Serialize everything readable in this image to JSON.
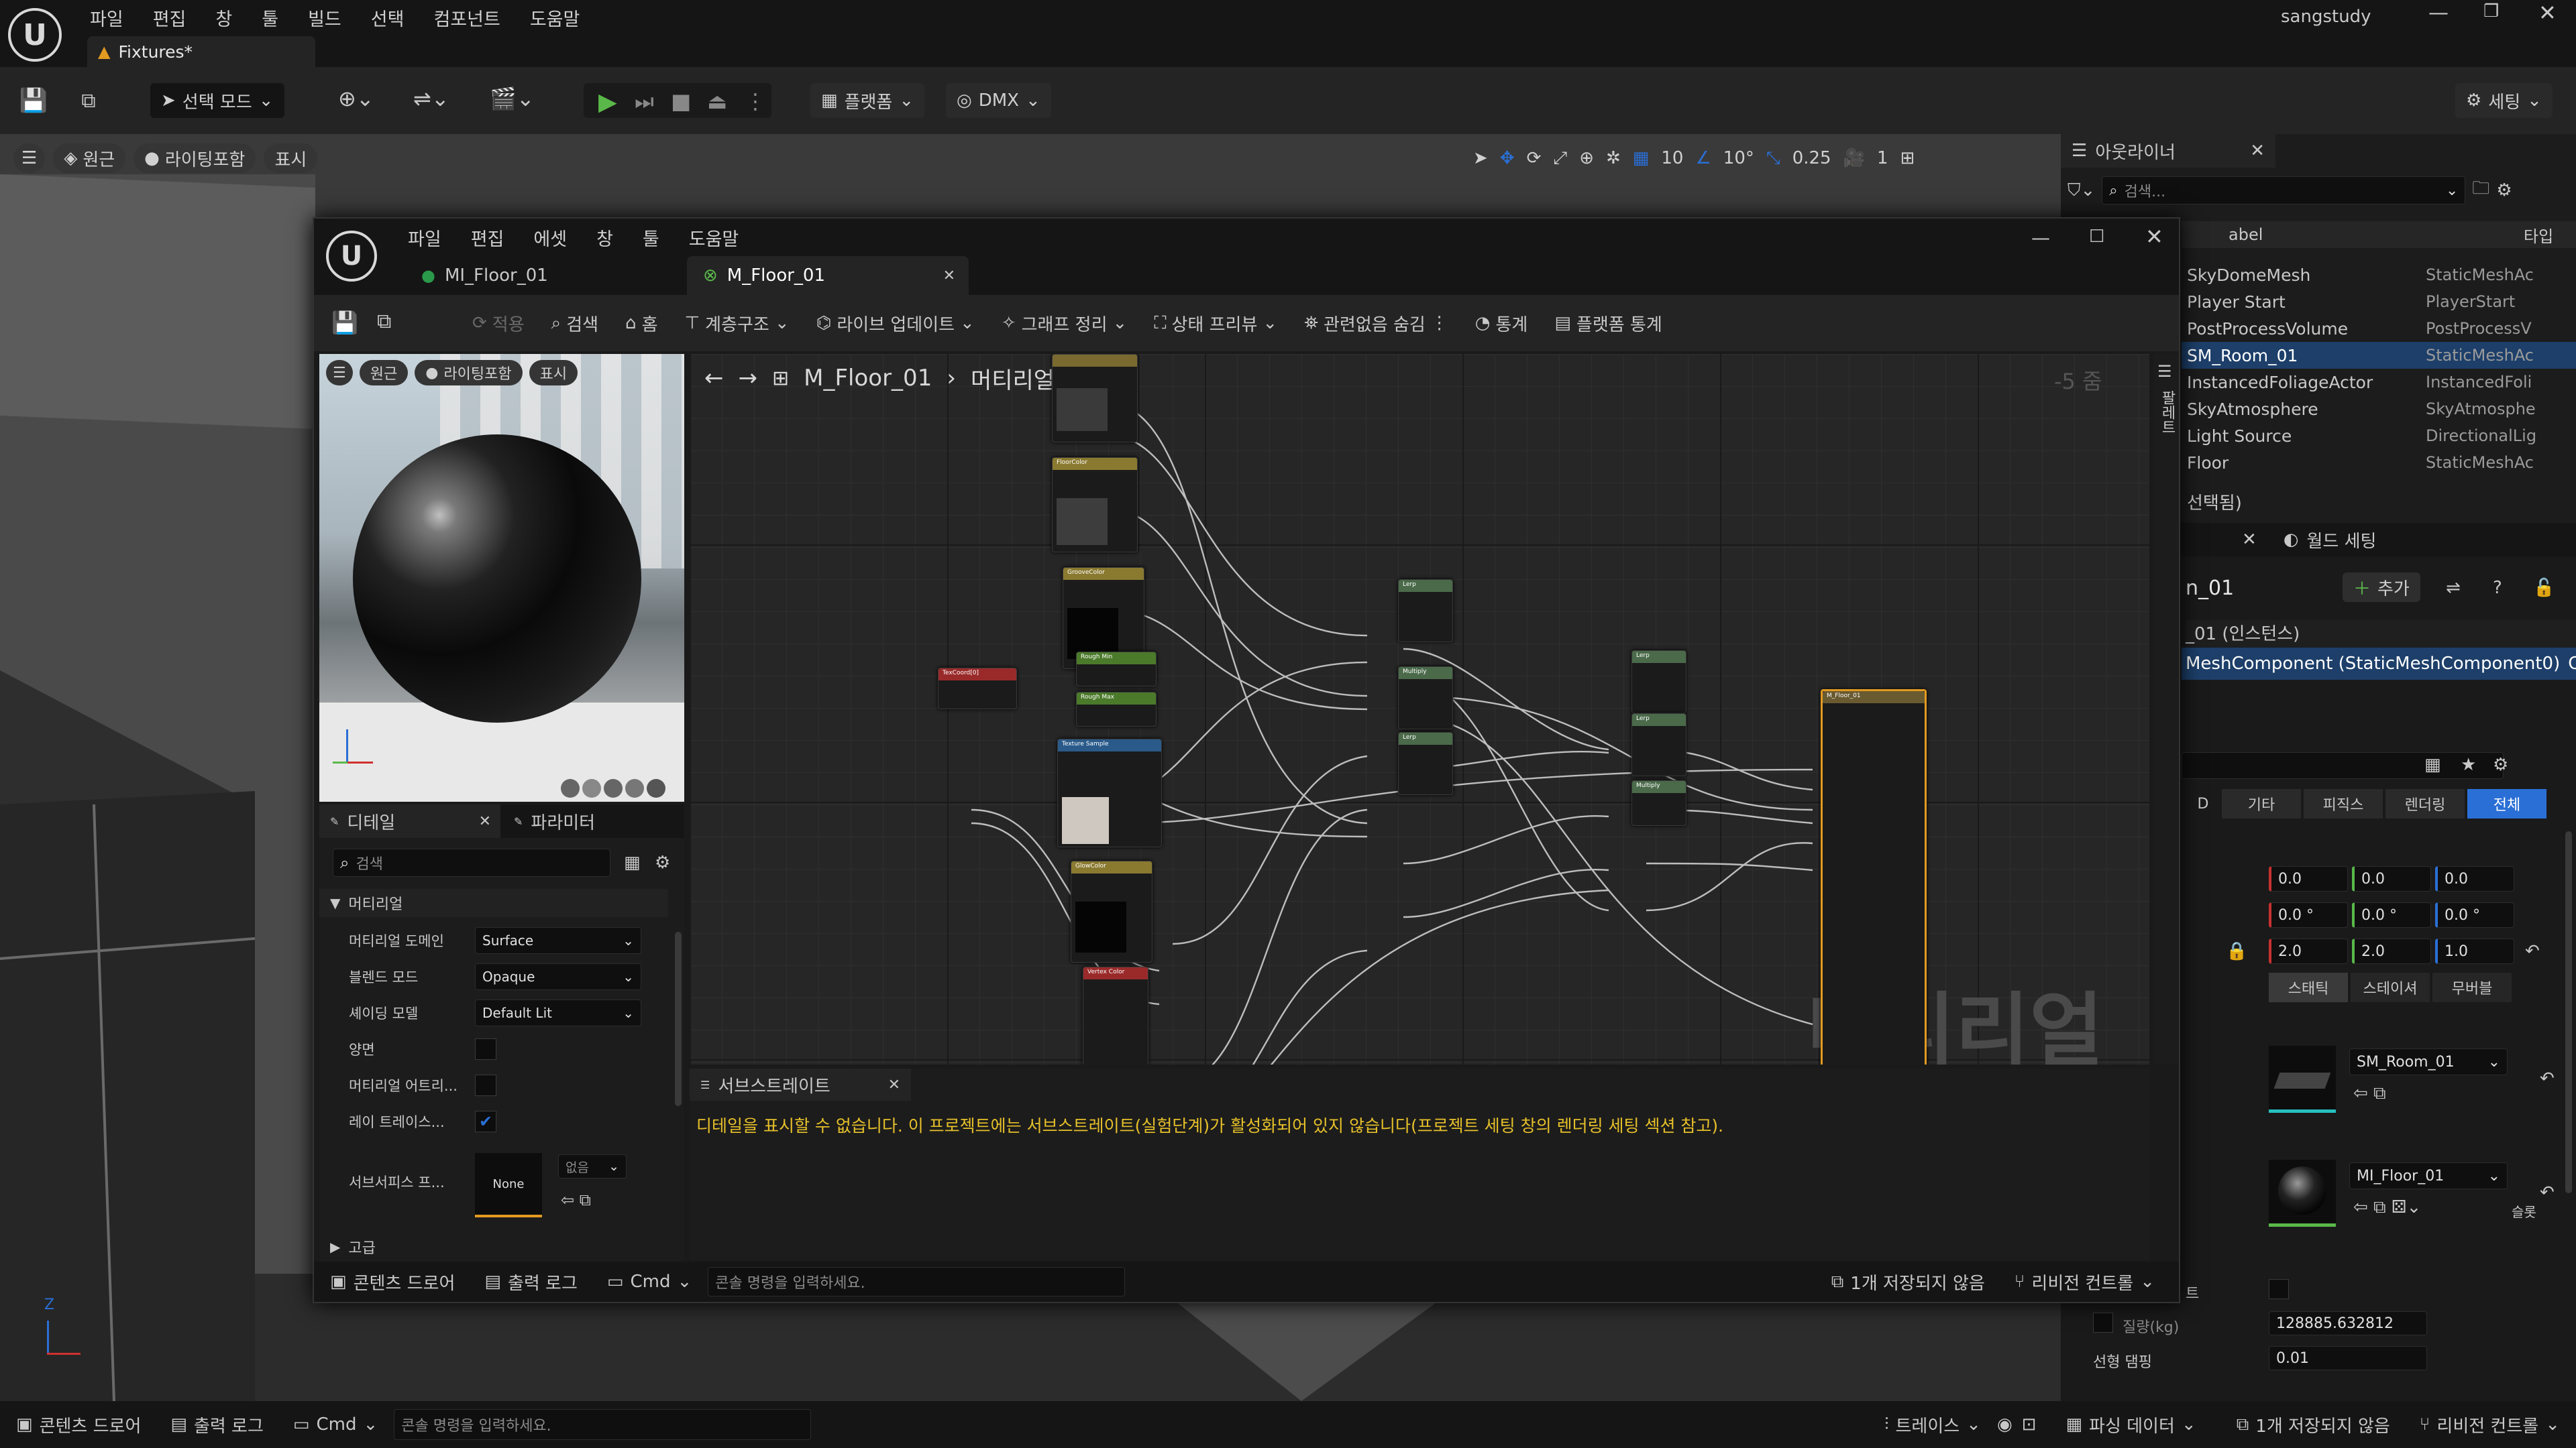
{
  "main_menu": [
    "파일",
    "편집",
    "창",
    "툴",
    "빌드",
    "선택",
    "컴포넌트",
    "도움말"
  ],
  "user": "sangstudy",
  "level_tab": "Fixtures*",
  "main_toolbar": {
    "select_mode": "선택 모드",
    "platforms": "플랫폼",
    "dmx": "DMX",
    "settings": "세팅"
  },
  "viewport_pills": {
    "perspective": "원근",
    "lit": "라이팅포함",
    "show": "표시"
  },
  "viewport_right": {
    "grid": "10",
    "angle": "10°",
    "scale": "0.25",
    "camera": "1"
  },
  "outliner": {
    "title": "아웃라이너",
    "search_placeholder": "검색...",
    "col_label": "abel",
    "col_type": "타입",
    "rows": [
      {
        "label": "SkyDomeMesh",
        "type": "StaticMeshAc"
      },
      {
        "label": "Player Start",
        "type": "PlayerStart"
      },
      {
        "label": "PostProcessVolume",
        "type": "PostProcessV"
      },
      {
        "label": "SM_Room_01",
        "type": "StaticMeshAc"
      },
      {
        "label": "InstancedFoliageActor",
        "type": "InstancedFoli"
      },
      {
        "label": "SkyAtmosphere",
        "type": "SkyAtmosphe"
      },
      {
        "label": "Light Source",
        "type": "DirectionalLig"
      },
      {
        "label": "Floor",
        "type": "StaticMeshAc"
      }
    ],
    "selected_count": "선택됨)"
  },
  "details_right": {
    "world_settings": "월드 세팅",
    "object_name": "n_01",
    "add": "추가",
    "instance": "_01 (인스턴스)",
    "component": "MeshComponent (StaticMeshComponent0)",
    "component_suffix": "C",
    "filter_tabs": [
      "D",
      "기타",
      "피직스",
      "렌더링",
      "전체"
    ],
    "loc": [
      "0.0",
      "0.0",
      "0.0"
    ],
    "rot": [
      "0.0 °",
      "0.0 °",
      "0.0 °"
    ],
    "scale": [
      "2.0",
      "2.0",
      "1.0"
    ],
    "mobility": [
      "스태틱",
      "스테이셔",
      "무버블"
    ],
    "mesh": "SM_Room_01",
    "material": "MI_Floor_01",
    "material_suffix": "슬롯",
    "mass_label": "질량(kg)",
    "mass_value": "128885.632812",
    "damp_label": "선형 댐핑",
    "damp_value": "0.01",
    "prop_label": "트"
  },
  "mat_editor": {
    "menu": [
      "파일",
      "편집",
      "에셋",
      "창",
      "툴",
      "도움말"
    ],
    "tabs": [
      "MI_Floor_01",
      "M_Floor_01"
    ],
    "toolbar": [
      "적용",
      "검색",
      "홈",
      "계층구조",
      "라이브 업데이트",
      "그래프 정리",
      "상태 프리뷰",
      "관련없음 숨김",
      "통계",
      "플랫폼 통계"
    ],
    "preview_pills": [
      "원근",
      "라이팅포함",
      "표시"
    ],
    "breadcrumb_root": "M_Floor_01",
    "breadcrumb_leaf": "머티리얼 그래프",
    "zoom": "-5 줌",
    "palette": "팔레트",
    "watermark": "머티리얼",
    "details_tab": "디테일",
    "params_tab": "파라미터",
    "search_placeholder": "검색",
    "section": "머티리얼",
    "props": [
      {
        "label": "머티리얼 도메인",
        "value": "Surface",
        "kind": "select"
      },
      {
        "label": "블렌드 모드",
        "value": "Opaque",
        "kind": "select"
      },
      {
        "label": "셰이딩 모델",
        "value": "Default Lit",
        "kind": "select"
      },
      {
        "label": "양면",
        "kind": "check",
        "checked": false
      },
      {
        "label": "머티리얼 어트리...",
        "kind": "check",
        "checked": false
      },
      {
        "label": "레이 트레이스...",
        "kind": "check",
        "checked": true
      }
    ],
    "subsurface_label": "서브서피스 프...",
    "subsurface_value": "None",
    "subsurface_dd": "없음",
    "advanced": "고급",
    "substrate_tab": "서브스트레이트",
    "substrate_msg": "디테일을 표시할 수 없습니다. 이 프로젝트에는 서브스트레이트(실험단계)가 활성화되어 있지 않습니다(프로젝트 세팅 창의 렌더링 세팅 섹션 참고).",
    "bottom": {
      "content": "콘텐츠 드로어",
      "log": "출력 로그",
      "cmd": "Cmd",
      "cmd_placeholder": "콘솔 명령을 입력하세요.",
      "unsaved": "1개 저장되지 않음",
      "revision": "리비전 컨트롤"
    }
  },
  "nodes": [
    {
      "id": "n1",
      "title": "",
      "color": "#7a6a30"
    },
    {
      "id": "n2",
      "title": "FloorColor",
      "color": "#8a7a30"
    },
    {
      "id": "n3",
      "title": "GrooveColor",
      "color": "#8a7a30"
    },
    {
      "id": "n4",
      "title": "TexCoord[0]",
      "color": "#9a2a2a"
    },
    {
      "id": "n5",
      "title": "Rough Min",
      "color": "#4a7a2a"
    },
    {
      "id": "n6",
      "title": "Rough Max",
      "color": "#4a7a2a"
    },
    {
      "id": "n7",
      "title": "Texture Sample",
      "color": "#2a5a8a"
    },
    {
      "id": "n8",
      "title": "GlowColor",
      "color": "#8a7a30"
    },
    {
      "id": "n9",
      "title": "Vertex Color",
      "color": "#9a2a2a"
    },
    {
      "id": "n10",
      "title": "Lerp",
      "color": "#4a6a4a"
    },
    {
      "id": "n11",
      "title": "Multiply",
      "color": "#4a6a4a"
    },
    {
      "id": "n12",
      "title": "Lerp",
      "color": "#4a6a4a"
    },
    {
      "id": "n13",
      "title": "Lerp",
      "color": "#4a6a4a"
    },
    {
      "id": "n14",
      "title": "Lerp",
      "color": "#4a6a4a"
    },
    {
      "id": "n15",
      "title": "Multiply",
      "color": "#4a6a4a"
    },
    {
      "id": "n16",
      "title": "M_Floor_01",
      "color": "#6a5a30"
    }
  ],
  "status_bar": {
    "content": "콘텐츠 드로어",
    "log": "출력 로그",
    "cmd": "Cmd",
    "cmd_placeholder": "콘솔 명령을 입력하세요.",
    "trace": "트레이스",
    "parse": "파싱 데이터",
    "unsaved": "1개 저장되지 않음",
    "revision": "리비전 컨트롤"
  },
  "colors": {
    "accent": "#2a6fd6",
    "play": "#5ab84a",
    "node_result": "#e39a20",
    "msg": "#e6c02a"
  }
}
